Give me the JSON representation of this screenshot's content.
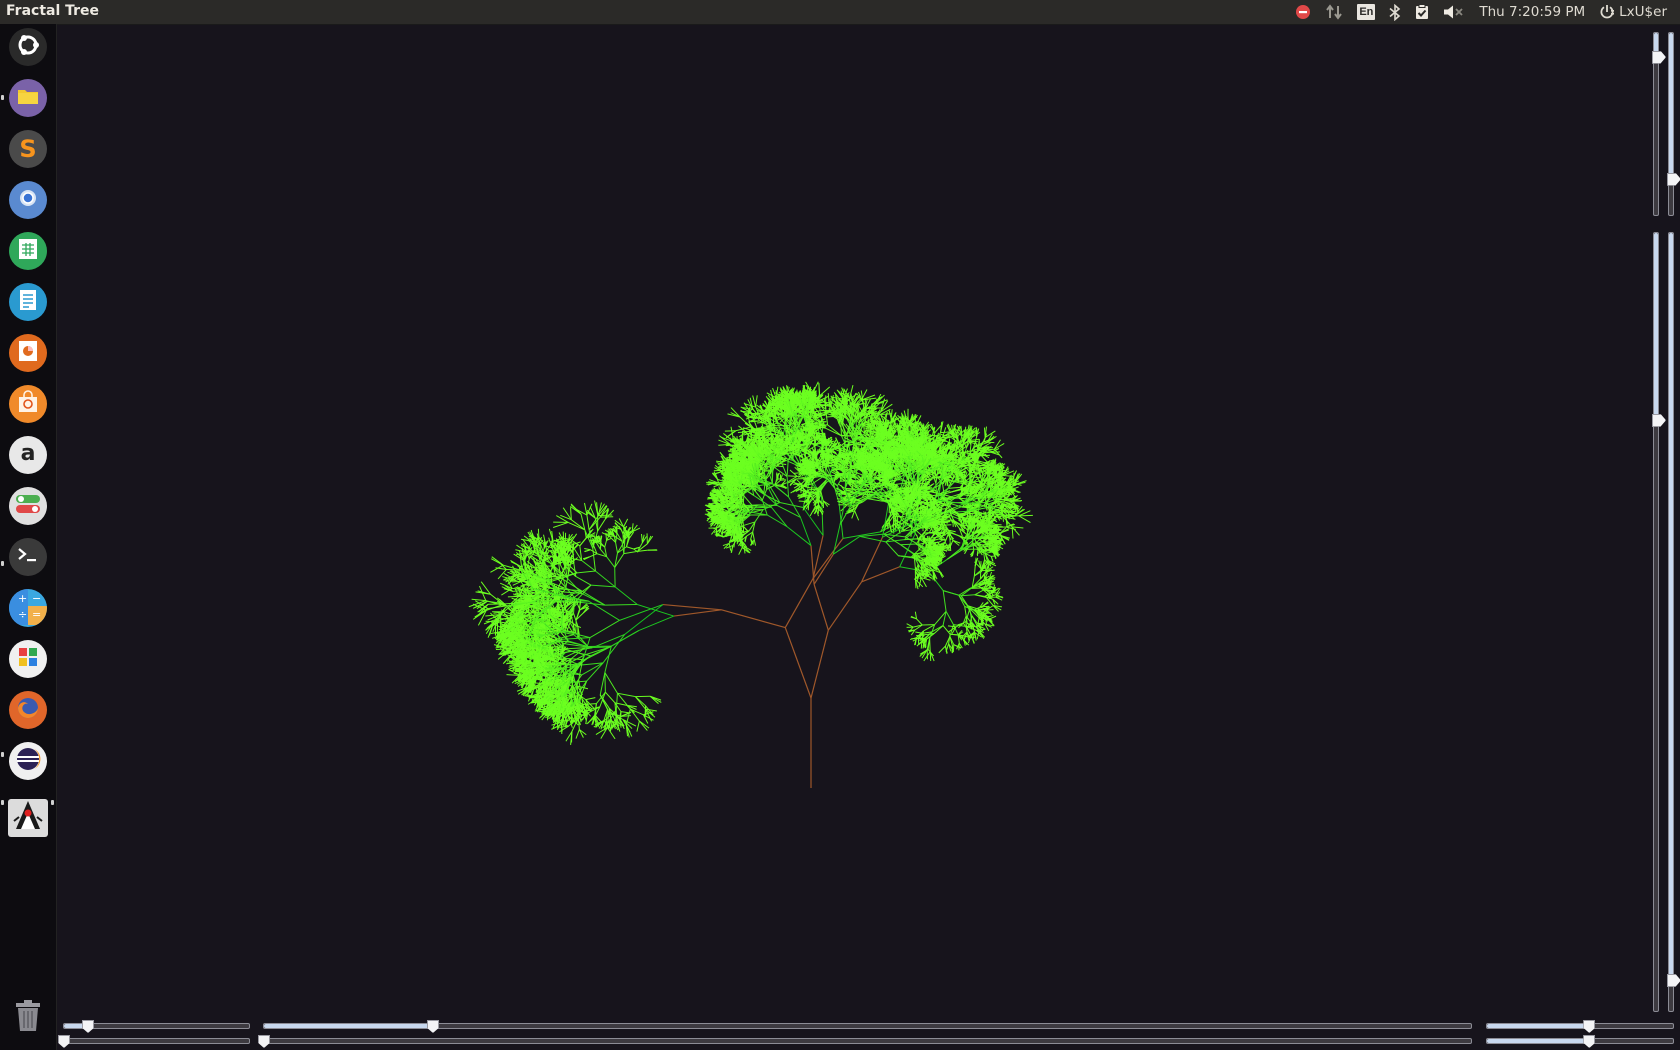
{
  "window": {
    "title": "Fractal Tree"
  },
  "tray": {
    "keyboard_layout": "En",
    "clock": "Thu  7:20:59 PM",
    "user": "LxU$er",
    "icons": [
      "stop-icon",
      "network-arrows-icon",
      "keyboard-layout-icon",
      "bluetooth-icon",
      "clipboard-check-icon",
      "volume-muted-icon",
      "session-power-icon"
    ]
  },
  "launcher": {
    "items": [
      {
        "name": "ubuntu-dash",
        "icon": "ubuntu-logo-icon",
        "color": "#2a2a2a"
      },
      {
        "name": "files",
        "icon": "folder-icon",
        "color": "#7a62a8"
      },
      {
        "name": "sublime-text",
        "icon": "sublime-s-icon",
        "color": "#4a4a4a"
      },
      {
        "name": "chromium",
        "icon": "chromium-icon",
        "color": "#5a8ad0"
      },
      {
        "name": "libreoffice-calc",
        "icon": "spreadsheet-icon",
        "color": "#2fa85a"
      },
      {
        "name": "libreoffice-writer",
        "icon": "document-icon",
        "color": "#2a9ad0"
      },
      {
        "name": "libreoffice-impress",
        "icon": "presentation-icon",
        "color": "#e06a1e"
      },
      {
        "name": "software-center",
        "icon": "shopping-bag-icon",
        "color": "#f08a2a"
      },
      {
        "name": "amazon",
        "icon": "amazon-icon",
        "color": "#e8e8e8"
      },
      {
        "name": "settings",
        "icon": "toggle-switches-icon",
        "color": "#e0e0e0"
      },
      {
        "name": "terminal",
        "icon": "terminal-icon",
        "color": "#3a3a3a"
      },
      {
        "name": "calculator",
        "icon": "calculator-icon",
        "color": "#3aa8e0"
      },
      {
        "name": "app-grid",
        "icon": "app-grid-icon",
        "color": "#f0f0f0"
      },
      {
        "name": "firefox",
        "icon": "firefox-icon",
        "color": "#e0662a"
      },
      {
        "name": "eclipse",
        "icon": "eclipse-icon",
        "color": "#f0f0f0"
      },
      {
        "name": "java-app",
        "icon": "java-duke-icon",
        "color": "#dcdcdc"
      }
    ],
    "trash": {
      "icon": "trash-icon"
    }
  },
  "colors": {
    "background": "#17141c",
    "trunk": "#a0582a",
    "leaf_dark": "#14c020",
    "leaf_light": "#6cff20"
  },
  "sliders": {
    "bottom_left_1": {
      "value": 0.13
    },
    "bottom_left_2": {
      "value": 0.0
    },
    "bottom_mid_1": {
      "value": 0.14
    },
    "bottom_mid_2": {
      "value": 0.0
    },
    "bottom_right_1": {
      "value": 0.55
    },
    "bottom_right_2": {
      "value": 0.55
    },
    "right_1": {
      "value": 0.13
    },
    "right_2": {
      "value": 0.8
    },
    "right_3": {
      "value": 0.24
    },
    "right_4": {
      "value": 0.96
    }
  }
}
